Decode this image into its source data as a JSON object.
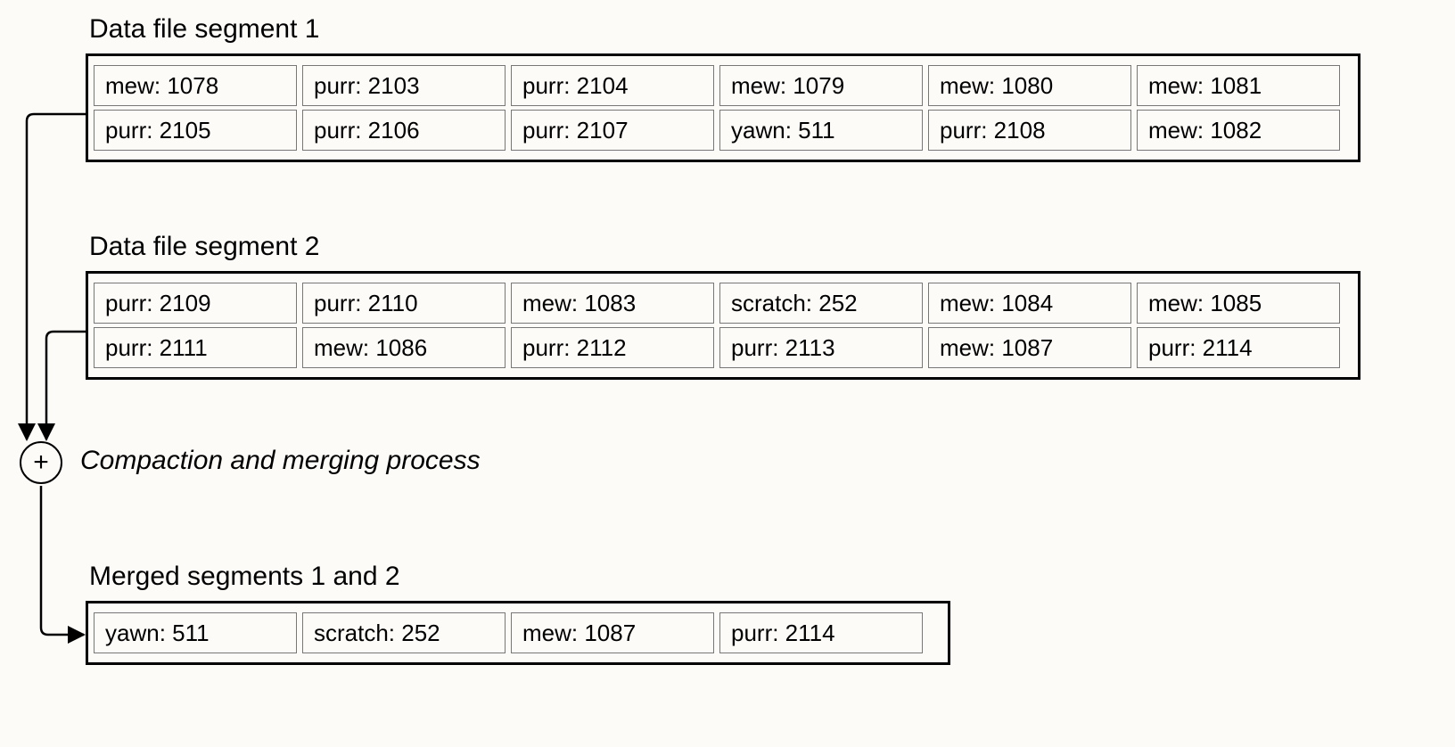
{
  "headings": {
    "seg1": "Data file segment 1",
    "seg2": "Data file segment 2",
    "merged": "Merged segments 1 and 2"
  },
  "process_label": "Compaction and merging process",
  "plus_symbol": "+",
  "segments": {
    "seg1": {
      "row0": [
        "mew: 1078",
        "purr: 2103",
        "purr: 2104",
        "mew: 1079",
        "mew: 1080",
        "mew: 1081"
      ],
      "row1": [
        "purr: 2105",
        "purr: 2106",
        "purr: 2107",
        "yawn: 511",
        "purr: 2108",
        "mew: 1082"
      ]
    },
    "seg2": {
      "row0": [
        "purr: 2109",
        "purr: 2110",
        "mew: 1083",
        "scratch: 252",
        "mew: 1084",
        "mew: 1085"
      ],
      "row1": [
        "purr: 2111",
        "mew: 1086",
        "purr: 2112",
        "purr: 2113",
        "mew: 1087",
        "purr: 2114"
      ]
    },
    "merged": {
      "row0": [
        "yawn: 511",
        "scratch: 252",
        "mew: 1087",
        "purr: 2114"
      ]
    }
  }
}
